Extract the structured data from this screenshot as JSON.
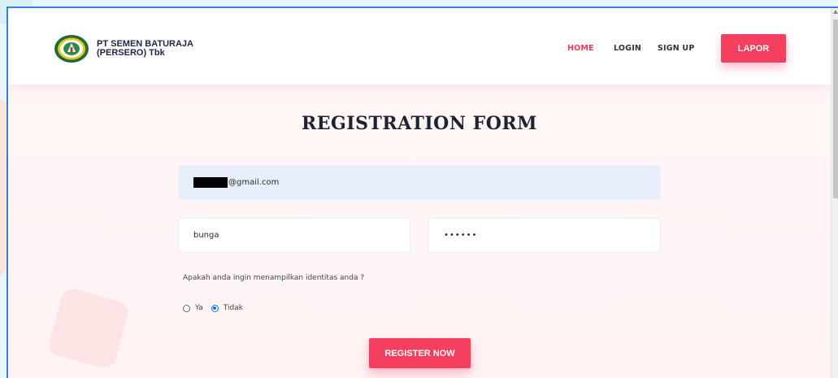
{
  "brand": {
    "line1": "PT SEMEN BATURAJA",
    "line2": "(PERSERO) Tbk",
    "logo_icon": "semen-baturaja-logo-icon"
  },
  "nav": {
    "home": "HOME",
    "login": "LOGIN",
    "signup": "SIGN UP",
    "lapor": "LAPOR"
  },
  "form": {
    "title": "REGISTRATION FORM",
    "email_value": "@gmail.com",
    "username_value": "bunga",
    "password_mask": "••••••",
    "question": "Apakah anda ingin menampilkan identitas anda ?",
    "options": [
      {
        "label": "Ya",
        "selected": false
      },
      {
        "label": "Tidak",
        "selected": true
      }
    ],
    "submit": "REGISTER NOW"
  },
  "colors": {
    "accent": "#f43f5e",
    "active_nav": "#ec3c55",
    "radio_selected": "#1a73e8",
    "email_field_bg": "#e8effc"
  }
}
